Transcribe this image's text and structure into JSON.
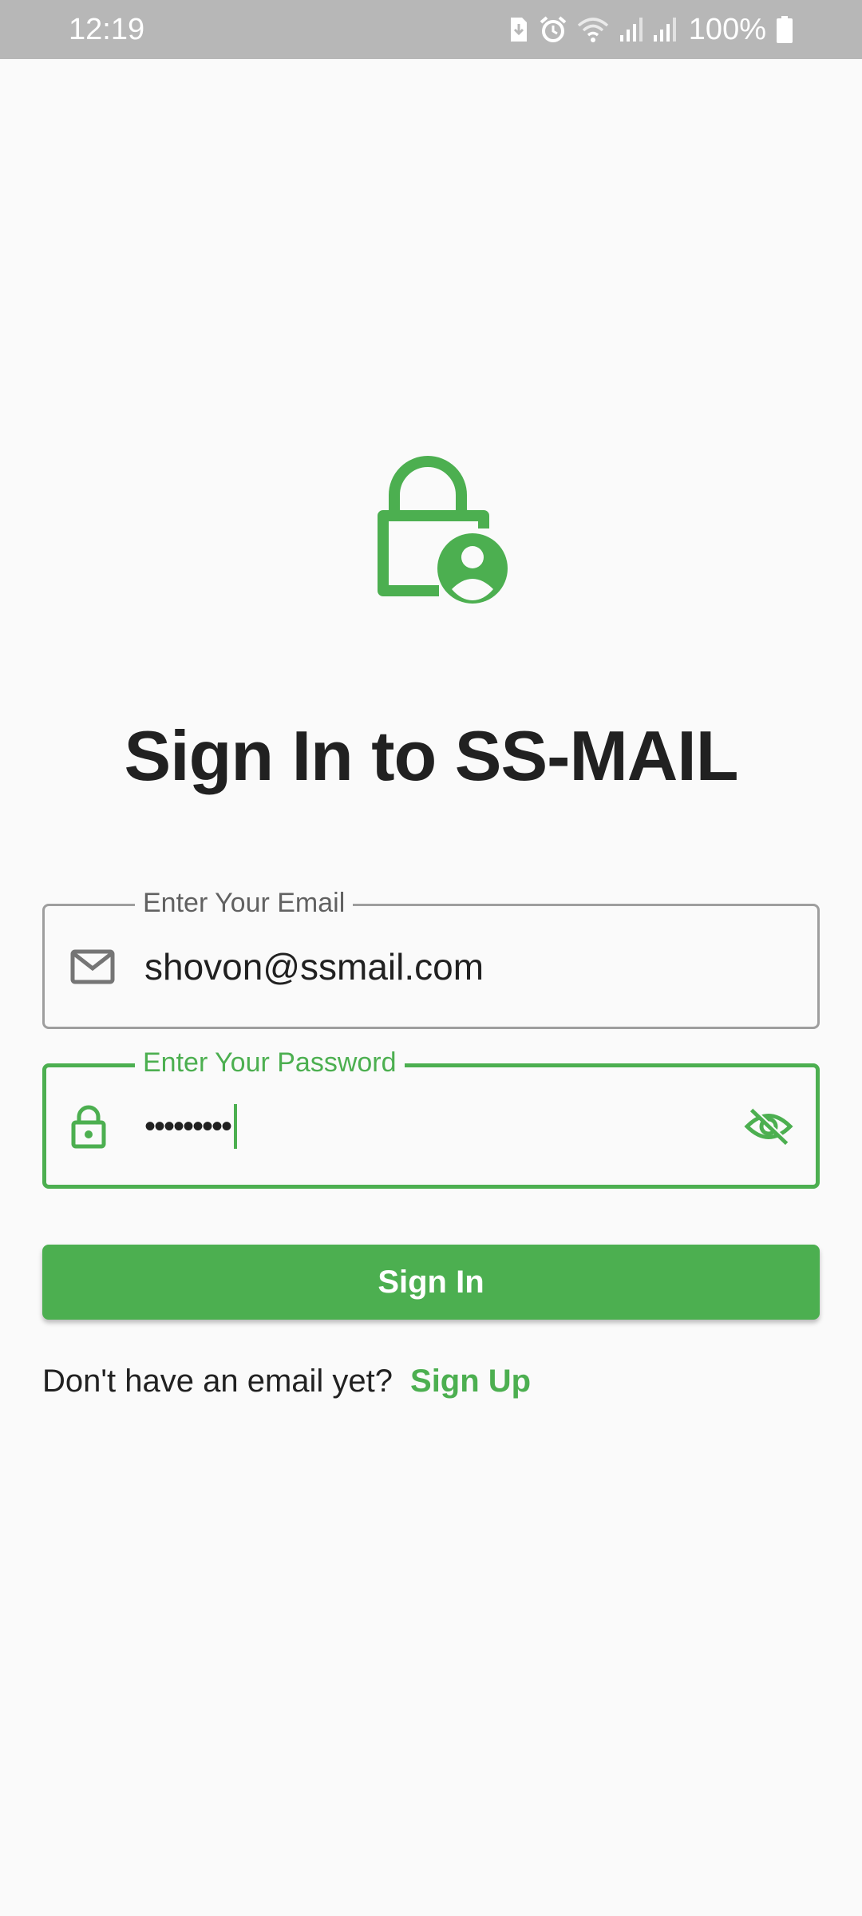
{
  "status_bar": {
    "time": "12:19",
    "battery": "100%",
    "icons": [
      "sim-icon",
      "alarm-icon",
      "wifi-icon",
      "signal-icon",
      "signal-icon",
      "battery-icon"
    ]
  },
  "hero": {
    "icon": "lock-person-icon"
  },
  "title": "Sign In to SS-MAIL",
  "email_field": {
    "label": "Enter Your Email",
    "value": "shovon@ssmail.com",
    "icon": "mail-icon"
  },
  "password_field": {
    "label": "Enter Your Password",
    "value": "•••••••••",
    "icon": "lock-icon",
    "toggle_icon": "visibility-off-icon"
  },
  "signin_button": {
    "label": "Sign In"
  },
  "signup": {
    "prompt": "Don't have an email yet?",
    "link": "Sign Up"
  },
  "colors": {
    "accent": "#4caf50",
    "status_bar": "#b7b7b7",
    "text": "#212121",
    "background": "#fafafa"
  }
}
